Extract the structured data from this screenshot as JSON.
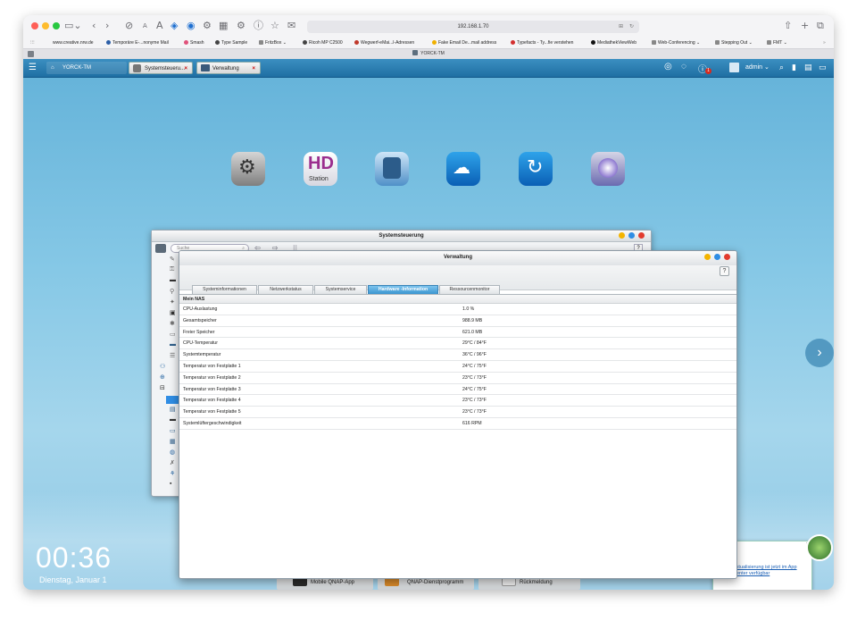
{
  "browser": {
    "url": "192.168.1.70",
    "tab_title": "YORCK-TM",
    "bookmarks": [
      {
        "label": "www.creative.nrw.de",
        "color": "#ffffff"
      },
      {
        "label": "Temporäre E-...nonyme Mail",
        "color": "#2b5ea7"
      },
      {
        "label": "Smash",
        "color": "#e0527b"
      },
      {
        "label": "Type Sample",
        "color": "#444444"
      },
      {
        "label": "FritzBox ⌄",
        "color": "#888888"
      },
      {
        "label": "Ricoh MP C2500",
        "color": "#444444"
      },
      {
        "label": "Wegwerf-eMai...l-Adressen",
        "color": "#c0392b"
      },
      {
        "label": "Fake Email De...mail address",
        "color": "#f0b000"
      },
      {
        "label": "Typefacts - Ty...fie verstehen",
        "color": "#d32f2f"
      },
      {
        "label": "MediathekViewWeb",
        "color": "#111111"
      },
      {
        "label": "Web-Conferencing ⌄",
        "color": "#888888"
      },
      {
        "label": "Stepping Out ⌄",
        "color": "#888888"
      },
      {
        "label": "FMT ⌄",
        "color": "#888888"
      }
    ]
  },
  "qnap": {
    "host_label": "YORCK-TM",
    "tabs": [
      {
        "label": "Systemsteueru...",
        "close": "×"
      },
      {
        "label": "Verwaltung",
        "close": "×"
      }
    ],
    "user": "admin ⌄",
    "notification_count": "1"
  },
  "desktop": {
    "clock": "00:36",
    "date": "Dienstag, Januar 1",
    "hd_station_label": "Station",
    "taskbar": [
      {
        "label": "Mobile QNAP-App"
      },
      {
        "label": "QNAP-Dienstprogramm"
      },
      {
        "label": "Rückmeldung"
      }
    ],
    "notification_link": "Aktualisierung ist jetzt im App Center verfügbar",
    "next_arrow": "›"
  },
  "systemsteuerung": {
    "title": "Systemsteuerung",
    "search_placeholder": "Suche",
    "help": "?"
  },
  "verwaltung": {
    "title": "Verwaltung",
    "help": "?",
    "tabs": [
      {
        "label": "Systeminformationen",
        "active": false
      },
      {
        "label": "Netzwerkstatus",
        "active": false
      },
      {
        "label": "Systemservice",
        "active": false
      },
      {
        "label": "Hardware -Information",
        "active": true
      },
      {
        "label": "Ressourcenmonitor",
        "active": false
      }
    ],
    "section": "Mein NAS",
    "rows": [
      {
        "label": "CPU-Auslastung",
        "value": "1.0 %"
      },
      {
        "label": "Gesamtspeicher",
        "value": "988.9 MB"
      },
      {
        "label": "Freier Speicher",
        "value": "621.0 MB"
      },
      {
        "label": "CPU-Temperatur",
        "value": "29°C / 84°F"
      },
      {
        "label": "Systemtemperatur",
        "value": "36°C / 96°F"
      },
      {
        "label": "Temperatur von Festplatte 1",
        "value": "24°C / 75°F"
      },
      {
        "label": "Temperatur von Festplatte 2",
        "value": "23°C / 73°F"
      },
      {
        "label": "Temperatur von Festplatte 3",
        "value": "24°C / 75°F"
      },
      {
        "label": "Temperatur von Festplatte 4",
        "value": "23°C / 73°F"
      },
      {
        "label": "Temperatur von Festplatte 5",
        "value": "23°C / 73°F"
      },
      {
        "label": "Systemlüftergeschwindigkeit",
        "value": "616 RPM"
      }
    ]
  }
}
